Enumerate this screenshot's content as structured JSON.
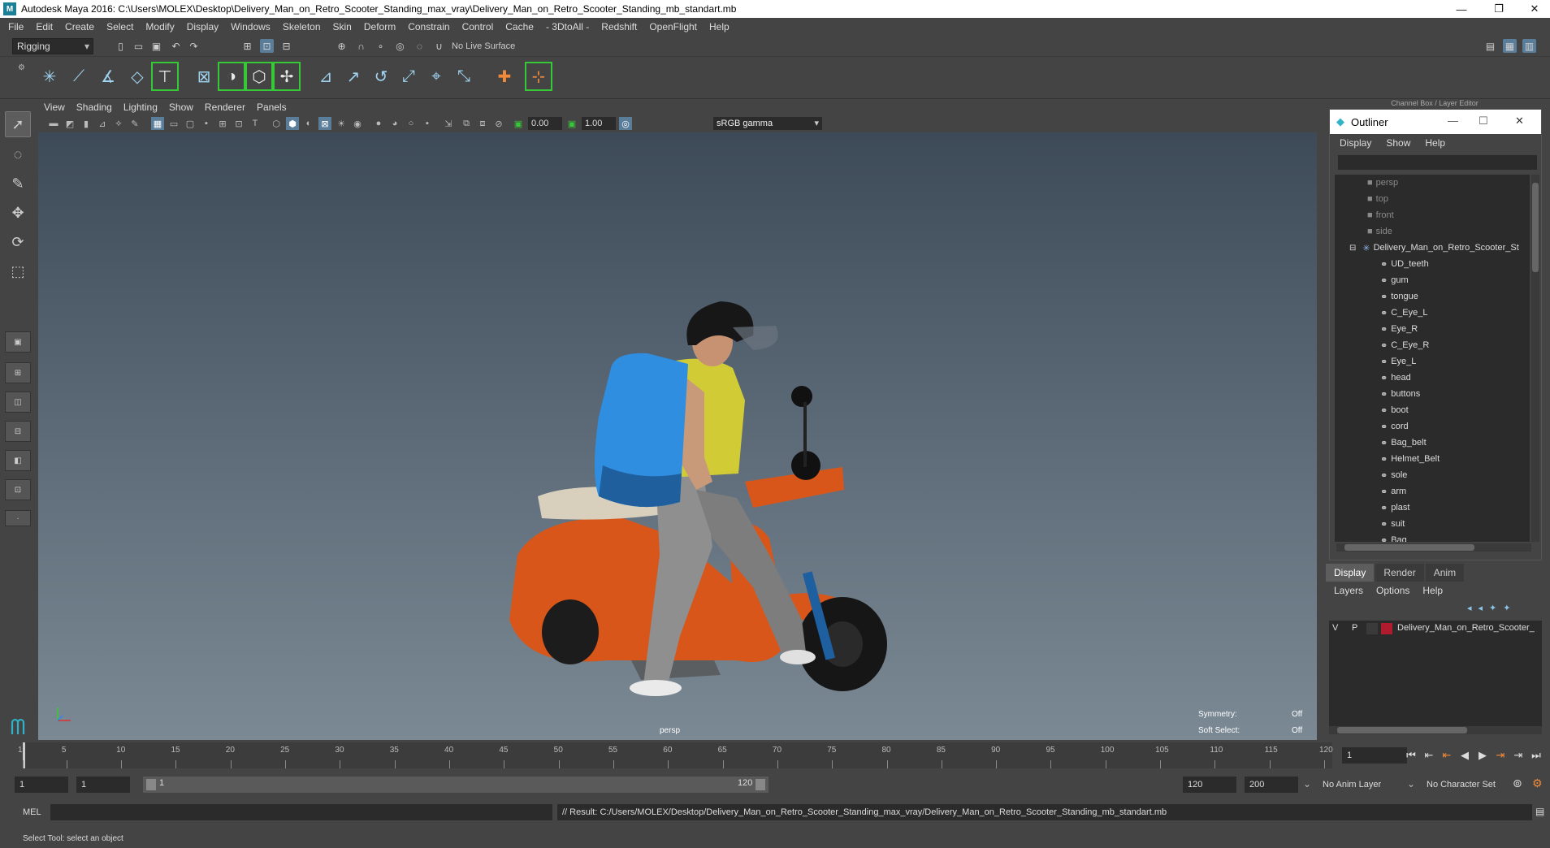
{
  "window": {
    "title": "Autodesk Maya 2016: C:\\Users\\MOLEX\\Desktop\\Delivery_Man_on_Retro_Scooter_Standing_max_vray\\Delivery_Man_on_Retro_Scooter_Standing_mb_standart.mb",
    "minimize": "—",
    "restore": "❐",
    "close": "✕"
  },
  "menubar": [
    "File",
    "Edit",
    "Create",
    "Select",
    "Modify",
    "Display",
    "Windows",
    "Skeleton",
    "Skin",
    "Deform",
    "Constrain",
    "Control",
    "Cache",
    "- 3DtoAll -",
    "Redshift",
    "OpenFlight",
    "Help"
  ],
  "statusline": {
    "mode": "Rigging",
    "live_surface": "No Live Surface"
  },
  "panel_menu": [
    "View",
    "Shading",
    "Lighting",
    "Show",
    "Renderer",
    "Panels"
  ],
  "panel_toolbar": {
    "exposure": "0.00",
    "gamma": "1.00",
    "color_space": "sRGB gamma"
  },
  "viewport": {
    "camera_label": "persp",
    "symmetry_label": "Symmetry:",
    "symmetry_value": "Off",
    "soft_select_label": "Soft Select:",
    "soft_select_value": "Off",
    "axis_y": "y",
    "axis_x": "x"
  },
  "outliner": {
    "header": "Channel Box / Layer Editor",
    "title": "Outliner",
    "menu": [
      "Display",
      "Show",
      "Help"
    ],
    "cameras": [
      "persp",
      "top",
      "front",
      "side"
    ],
    "root": "Delivery_Man_on_Retro_Scooter_St",
    "children": [
      "UD_teeth",
      "gum",
      "tongue",
      "C_Eye_L",
      "Eye_R",
      "C_Eye_R",
      "Eye_L",
      "head",
      "buttons",
      "boot",
      "cord",
      "Bag_belt",
      "Helmet_Belt",
      "sole",
      "arm",
      "plast",
      "suit",
      "Bag"
    ]
  },
  "layer_editor": {
    "tabs": [
      "Display",
      "Render",
      "Anim"
    ],
    "menu": [
      "Layers",
      "Options",
      "Help"
    ],
    "layer": {
      "v": "V",
      "p": "P",
      "name": "Delivery_Man_on_Retro_Scooter_",
      "color": "#b01c2e"
    }
  },
  "timeline": {
    "ticks": [
      "1",
      "5",
      "10",
      "15",
      "20",
      "25",
      "30",
      "35",
      "40",
      "45",
      "50",
      "55",
      "60",
      "65",
      "70",
      "75",
      "80",
      "85",
      "90",
      "95",
      "100",
      "105",
      "110",
      "115",
      "120"
    ],
    "current_frame": "1"
  },
  "range": {
    "start": "1",
    "playback_start": "1",
    "slider_start": "1",
    "slider_end": "120",
    "playback_end": "120",
    "end": "200",
    "anim_layer": "No Anim Layer",
    "character_set": "No Character Set"
  },
  "command": {
    "lang": "MEL",
    "result": "// Result: C:/Users/MOLEX/Desktop/Delivery_Man_on_Retro_Scooter_Standing_max_vray/Delivery_Man_on_Retro_Scooter_Standing_mb_standart.mb"
  },
  "helpline": "Select Tool: select an object",
  "colors": {
    "accent": "#5a7d9a",
    "shelf_highlight": "#37c837",
    "viewport_top": "#3d4a58",
    "viewport_bottom": "#7b8994"
  }
}
